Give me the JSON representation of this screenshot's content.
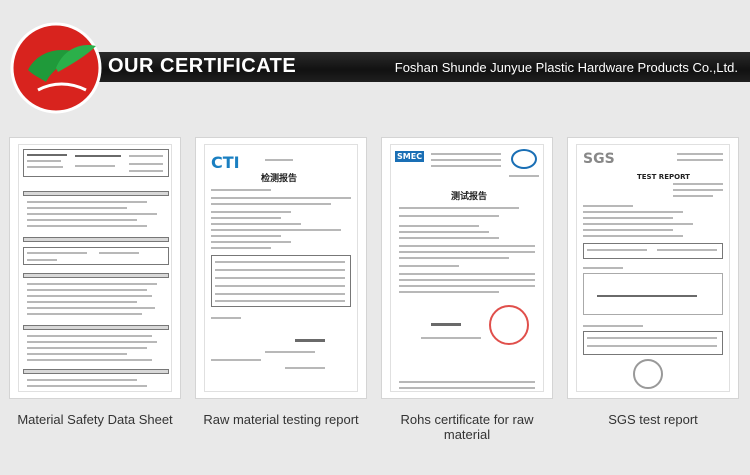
{
  "header": {
    "title": "OUR CERTIFICATE",
    "company": "Foshan Shunde Junyue Plastic Hardware Products Co.,Ltd."
  },
  "certificates": [
    {
      "label": "Material Safety Data Sheet"
    },
    {
      "label": "Raw material testing report",
      "logo_text": "CTI",
      "doc_title": "检测报告"
    },
    {
      "label": "Rohs certificate for raw material",
      "logo_text": "SMEC",
      "doc_title": "测试报告"
    },
    {
      "label": "SGS test report",
      "logo_text": "SGS",
      "doc_title": "TEST REPORT"
    }
  ],
  "colors": {
    "banner": "#111111",
    "logo_red": "#d8231e",
    "logo_green": "#1f9a3a",
    "page_bg": "#e9e9e9"
  }
}
